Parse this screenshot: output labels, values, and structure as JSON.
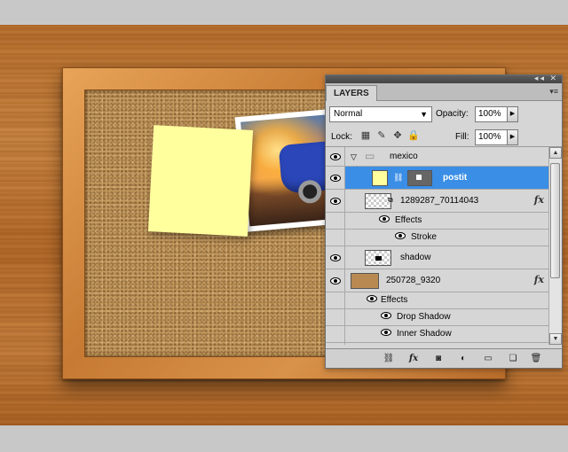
{
  "panel": {
    "tab": "LAYERS",
    "blend_mode": "Normal",
    "opacity_label": "Opacity:",
    "opacity_value": "100%",
    "lock_label": "Lock:",
    "fill_label": "Fill:",
    "fill_value": "100%"
  },
  "layers": {
    "group": "mexico",
    "postit": "postit",
    "photo": "1289287_70114043",
    "photo_effects": "Effects",
    "photo_stroke": "Stroke",
    "shadow": "shadow",
    "board": "250728_9320",
    "board_effects": "Effects",
    "board_drop_shadow": "Drop Shadow",
    "board_inner_shadow": "Inner Shadow"
  },
  "colors": {
    "selection": "#3a8ee6",
    "postit": "#ffff9e"
  }
}
